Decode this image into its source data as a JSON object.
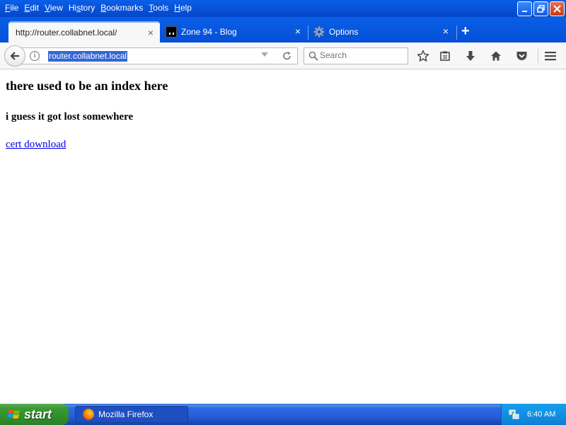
{
  "menubar": {
    "items": [
      {
        "label": "File",
        "ul": "F",
        "rest": "ile"
      },
      {
        "label": "Edit",
        "ul": "E",
        "rest": "dit"
      },
      {
        "label": "View",
        "ul": "V",
        "rest": "iew"
      },
      {
        "label": "History",
        "ul": "H",
        "pre": "Hi",
        "ul2": "s",
        "rest": "tory"
      },
      {
        "label": "Bookmarks",
        "ul": "B",
        "rest": "ookmarks"
      },
      {
        "label": "Tools",
        "ul": "T",
        "rest": "ools"
      },
      {
        "label": "Help",
        "ul": "H",
        "rest": "elp"
      }
    ]
  },
  "tabs": [
    {
      "title": "http://router.collabnet.local/",
      "active": true
    },
    {
      "title": "Zone 94 - Blog",
      "active": false
    },
    {
      "title": "Options",
      "active": false
    }
  ],
  "navbar": {
    "url": "router.collabnet.local",
    "search_placeholder": "Search"
  },
  "page": {
    "heading": "there used to be an index here",
    "subheading": "i guess it got lost somewhere",
    "link_text": "cert download"
  },
  "taskbar": {
    "start_label": "start",
    "task_label": "Mozilla Firefox",
    "clock": "6:40 AM"
  },
  "colors": {
    "xp_blue": "#0a5fe8",
    "start_green": "#3c9b34",
    "link": "#0000ee",
    "url_highlight": "#3367d6"
  }
}
